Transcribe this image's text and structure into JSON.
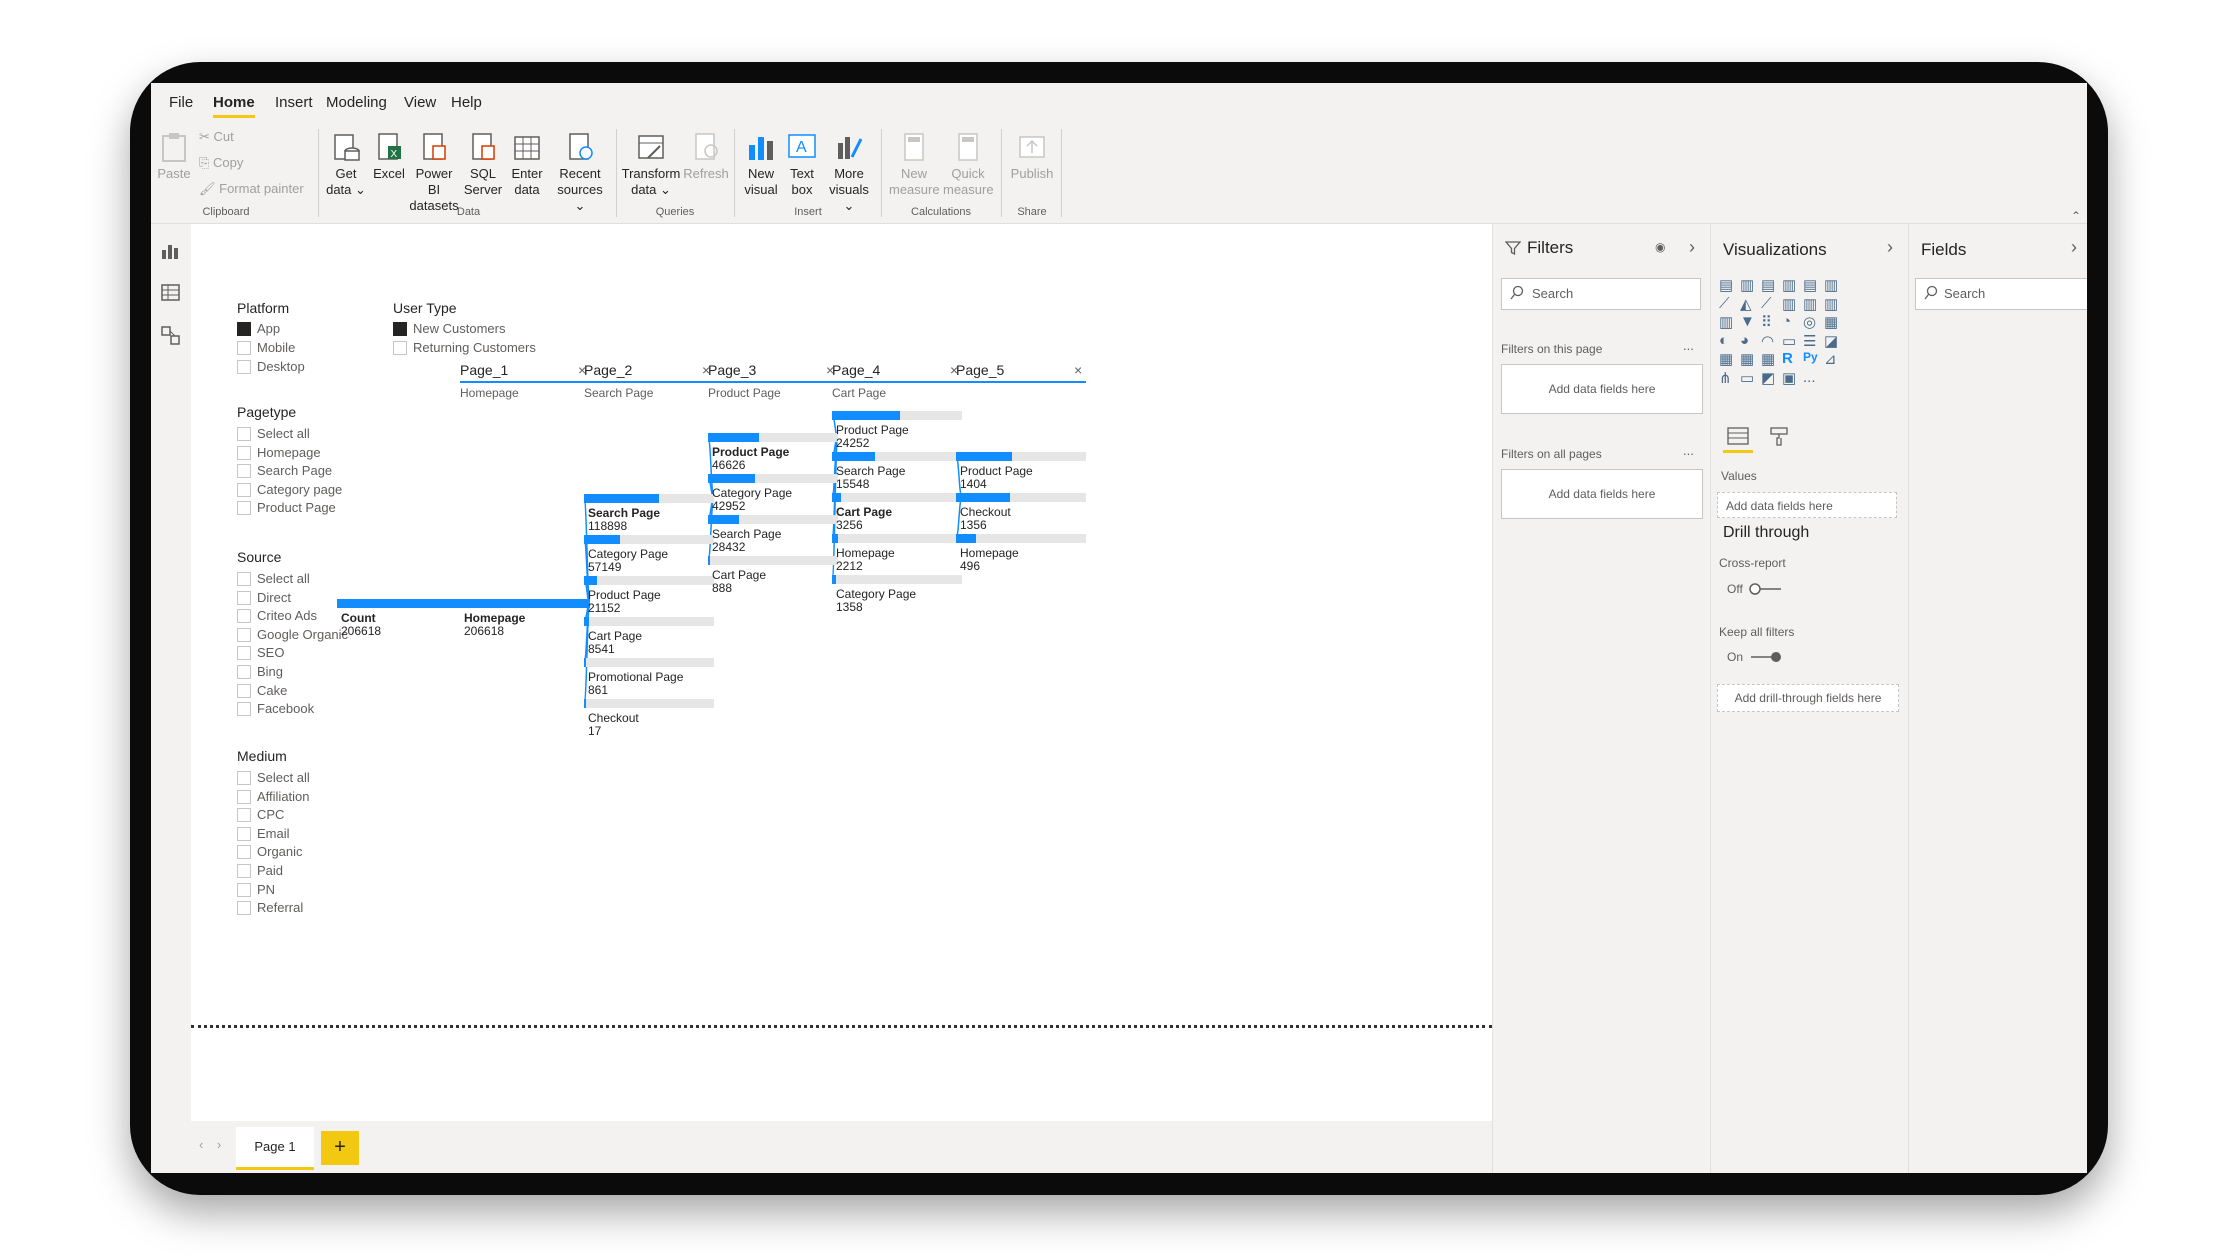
{
  "menu": {
    "items": [
      "File",
      "Home",
      "Insert",
      "Modeling",
      "View",
      "Help"
    ],
    "active": "Home"
  },
  "ribbon": {
    "paste": "Paste",
    "cut": "Cut",
    "copy": "Copy",
    "format_painter": "Format painter",
    "get_data": [
      "Get",
      "data ⌄"
    ],
    "excel": "Excel",
    "pbi_datasets": [
      "Power BI",
      "datasets"
    ],
    "sql": [
      "SQL",
      "Server"
    ],
    "enter_data": [
      "Enter",
      "data"
    ],
    "recent": [
      "Recent",
      "sources ⌄"
    ],
    "transform": [
      "Transform",
      "data ⌄"
    ],
    "refresh": "Refresh",
    "new_visual": [
      "New",
      "visual"
    ],
    "text_box": [
      "Text",
      "box"
    ],
    "more_visuals": [
      "More",
      "visuals ⌄"
    ],
    "new_measure": [
      "New",
      "measure"
    ],
    "quick_measure": [
      "Quick",
      "measure"
    ],
    "publish": "Publish",
    "groups": {
      "clipboard": "Clipboard",
      "data": "Data",
      "queries": "Queries",
      "insert": "Insert",
      "calculations": "Calculations",
      "share": "Share"
    }
  },
  "slicers": {
    "platform": {
      "title": "Platform",
      "items": [
        {
          "label": "App",
          "checked": true
        },
        {
          "label": "Mobile",
          "checked": false
        },
        {
          "label": "Desktop",
          "checked": false
        }
      ]
    },
    "user_type": {
      "title": "User Type",
      "items": [
        {
          "label": "New Customers",
          "checked": true
        },
        {
          "label": "Returning Customers",
          "checked": false
        }
      ]
    },
    "pagetype": {
      "title": "Pagetype",
      "items": [
        {
          "label": "Select all",
          "checked": false
        },
        {
          "label": "Homepage",
          "checked": false
        },
        {
          "label": "Search Page",
          "checked": false
        },
        {
          "label": "Category page",
          "checked": false
        },
        {
          "label": "Product Page",
          "checked": false
        }
      ]
    },
    "source": {
      "title": "Source",
      "items": [
        {
          "label": "Select all",
          "checked": false
        },
        {
          "label": "Direct",
          "checked": false
        },
        {
          "label": "Criteo Ads",
          "checked": false
        },
        {
          "label": "Google Organic",
          "checked": false
        },
        {
          "label": "SEO",
          "checked": false
        },
        {
          "label": "Bing",
          "checked": false
        },
        {
          "label": "Cake",
          "checked": false
        },
        {
          "label": "Facebook",
          "checked": false
        }
      ]
    },
    "medium": {
      "title": "Medium",
      "items": [
        {
          "label": "Select all",
          "checked": false
        },
        {
          "label": "Affiliation",
          "checked": false
        },
        {
          "label": "CPC",
          "checked": false
        },
        {
          "label": "Email",
          "checked": false
        },
        {
          "label": "Organic",
          "checked": false
        },
        {
          "label": "Paid",
          "checked": false
        },
        {
          "label": "PN",
          "checked": false
        },
        {
          "label": "Referral",
          "checked": false
        }
      ]
    }
  },
  "tree": {
    "levels": [
      {
        "name": "Page_1",
        "selected": "Homepage"
      },
      {
        "name": "Page_2",
        "selected": "Search Page"
      },
      {
        "name": "Page_3",
        "selected": "Product Page"
      },
      {
        "name": "Page_4",
        "selected": "Cart Page"
      },
      {
        "name": "Page_5",
        "selected": ""
      }
    ],
    "root": {
      "label": "Count",
      "value": "206618",
      "fraction": 1.0
    },
    "columns": [
      [
        {
          "label": "Homepage",
          "value": "206618",
          "fraction": 1.0,
          "bold": true
        }
      ],
      [
        {
          "label": "Search Page",
          "value": "118898",
          "fraction": 0.575,
          "bold": true
        },
        {
          "label": "Category Page",
          "value": "57149",
          "fraction": 0.277
        },
        {
          "label": "Product Page",
          "value": "21152",
          "fraction": 0.102
        },
        {
          "label": "Cart Page",
          "value": "8541",
          "fraction": 0.041
        },
        {
          "label": "Promotional Page",
          "value": "861",
          "fraction": 0.004
        },
        {
          "label": "Checkout",
          "value": "17",
          "fraction": 0.0001
        }
      ],
      [
        {
          "label": "Product Page",
          "value": "46626",
          "fraction": 0.392,
          "bold": true
        },
        {
          "label": "Category Page",
          "value": "42952",
          "fraction": 0.361
        },
        {
          "label": "Search Page",
          "value": "28432",
          "fraction": 0.239
        },
        {
          "label": "Cart Page",
          "value": "888",
          "fraction": 0.0075
        }
      ],
      [
        {
          "label": "Product Page",
          "value": "24252",
          "fraction": 0.52
        },
        {
          "label": "Search Page",
          "value": "15548",
          "fraction": 0.333
        },
        {
          "label": "Cart Page",
          "value": "3256",
          "fraction": 0.07,
          "bold": true
        },
        {
          "label": "Homepage",
          "value": "2212",
          "fraction": 0.047
        },
        {
          "label": "Category Page",
          "value": "1358",
          "fraction": 0.029
        }
      ],
      [
        {
          "label": "Product Page",
          "value": "1404",
          "fraction": 0.431
        },
        {
          "label": "Checkout",
          "value": "1356",
          "fraction": 0.416
        },
        {
          "label": "Homepage",
          "value": "496",
          "fraction": 0.152
        }
      ]
    ],
    "colors": {
      "bar": "#118dff",
      "track": "#e6e6e6",
      "link": "#118dff"
    }
  },
  "page_tabs": {
    "tabs": [
      "Page 1"
    ],
    "add": "+"
  },
  "filters": {
    "title": "Filters",
    "search_placeholder": "Search",
    "on_this_page": "Filters on this page",
    "on_all_pages": "Filters on all pages",
    "add_fields": "Add data fields here",
    "more": "..."
  },
  "visualizations": {
    "title": "Visualizations",
    "values_label": "Values",
    "add_fields": "Add data fields here",
    "drill_through": "Drill through",
    "cross_report": "Cross-report",
    "cross_report_state": "Off",
    "keep_all_filters": "Keep all filters",
    "keep_state": "On",
    "add_drill": "Add drill-through fields here",
    "r_label": "R",
    "py_label": "Py",
    "more": "..."
  },
  "fields": {
    "title": "Fields",
    "search_placeholder": "Search"
  }
}
